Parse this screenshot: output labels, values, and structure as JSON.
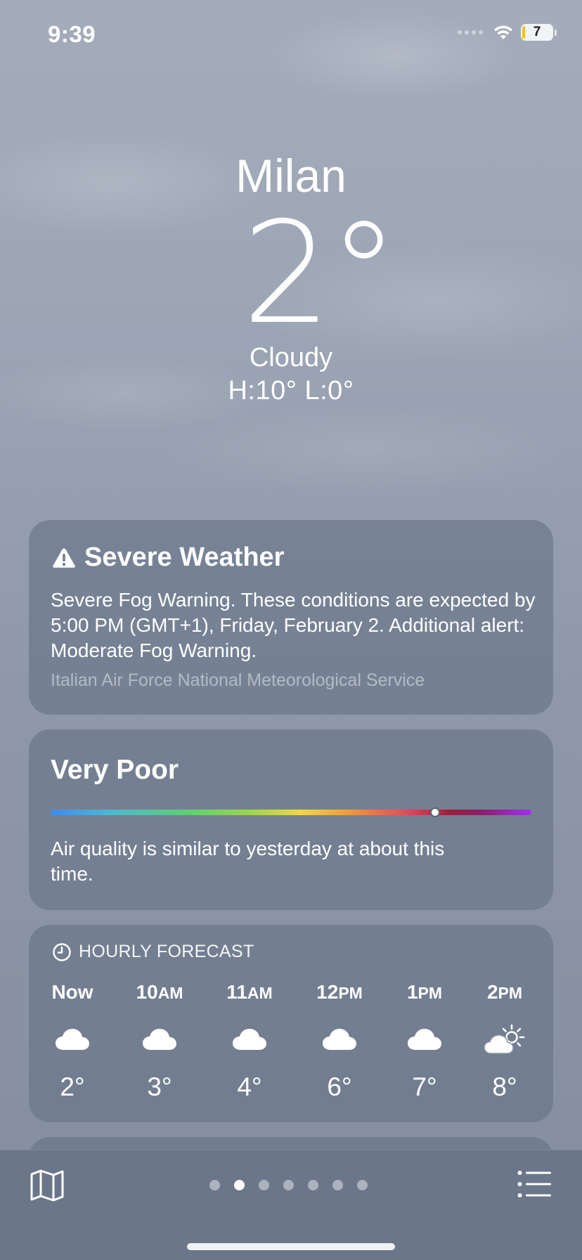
{
  "status_bar": {
    "time": "9:39",
    "battery_level": "7"
  },
  "current": {
    "city": "Milan",
    "temperature": "2°",
    "condition": "Cloudy",
    "high_low": "H:10°  L:0°"
  },
  "alert": {
    "icon": "warning-triangle-icon",
    "title": "Severe Weather",
    "body": "Severe Fog Warning. These conditions are expected by 5:00 PM (GMT+1), Friday, February 2. Additional alert: Moderate Fog Warning.",
    "source": "Italian Air Force National Meteorological Service"
  },
  "air_quality": {
    "category": "Very Poor",
    "scale_position": 0.8,
    "description": "Air quality is similar to yesterday at about this time."
  },
  "hourly": {
    "header": "HOURLY FORECAST",
    "items": [
      {
        "hour": "Now",
        "suffix": "",
        "icon": "cloud-icon",
        "temp": "2°"
      },
      {
        "hour": "10",
        "suffix": "AM",
        "icon": "cloud-icon",
        "temp": "3°"
      },
      {
        "hour": "11",
        "suffix": "AM",
        "icon": "cloud-icon",
        "temp": "4°"
      },
      {
        "hour": "12",
        "suffix": "PM",
        "icon": "cloud-icon",
        "temp": "6°"
      },
      {
        "hour": "1",
        "suffix": "PM",
        "icon": "cloud-icon",
        "temp": "7°"
      },
      {
        "hour": "2",
        "suffix": "PM",
        "icon": "sun-behind-cloud-icon",
        "temp": "8°"
      }
    ]
  },
  "bottom_bar": {
    "map_icon": "map-icon",
    "list_icon": "list-icon",
    "page_count": 7,
    "active_page": 2
  }
}
